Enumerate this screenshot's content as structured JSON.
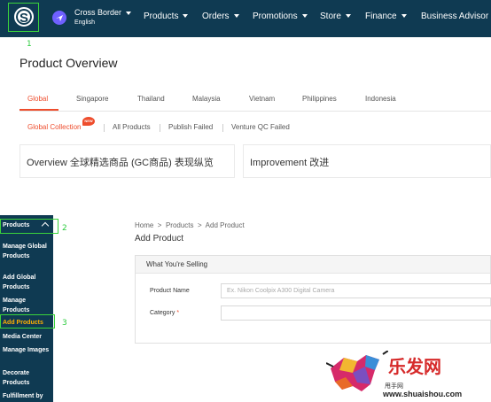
{
  "topbar": {
    "seller_name": "Cross Border",
    "language": "English",
    "nav": [
      "Products",
      "Orders",
      "Promotions",
      "Store",
      "Finance",
      "Business Advisor"
    ],
    "annotation": "1"
  },
  "overview": {
    "title": "Product Overview",
    "tabs": [
      "Global",
      "Singapore",
      "Thailand",
      "Malaysia",
      "Vietnam",
      "Philippines",
      "Indonesia"
    ],
    "subtabs": [
      "Global Collection",
      "All Products",
      "Publish Failed",
      "Venture QC Failed"
    ],
    "new_badge": "NEW",
    "cards": [
      "Overview 全球精选商品 (GC商品) 表现纵览",
      "Improvement 改进"
    ]
  },
  "sidebar": {
    "header": "Products",
    "header_annotation": "2",
    "items": [
      "Manage Global Products",
      "Add Global Products",
      "Manage Products",
      "Add Products",
      "Media Center",
      "Manage Images",
      "Decorate Products",
      "Fulfillment by"
    ],
    "active_annotation": "3"
  },
  "main": {
    "breadcrumb": [
      "Home",
      "Products",
      "Add Product"
    ],
    "title": "Add Product",
    "section_title": "What You're Selling",
    "product_name_label": "Product Name",
    "product_name_placeholder": "Ex. Nikon Coolpix A300 Digital Camera",
    "category_label": "Category",
    "required_mark": "*"
  },
  "watermark": {
    "title": "乐发网",
    "subtitle": "甩手网",
    "url": "www.shuaishou.com"
  },
  "colors": {
    "nav_bg": "#0f3a52",
    "accent": "#ee4d2d",
    "highlight": "#3bd43b",
    "active_item": "#ffb000"
  }
}
